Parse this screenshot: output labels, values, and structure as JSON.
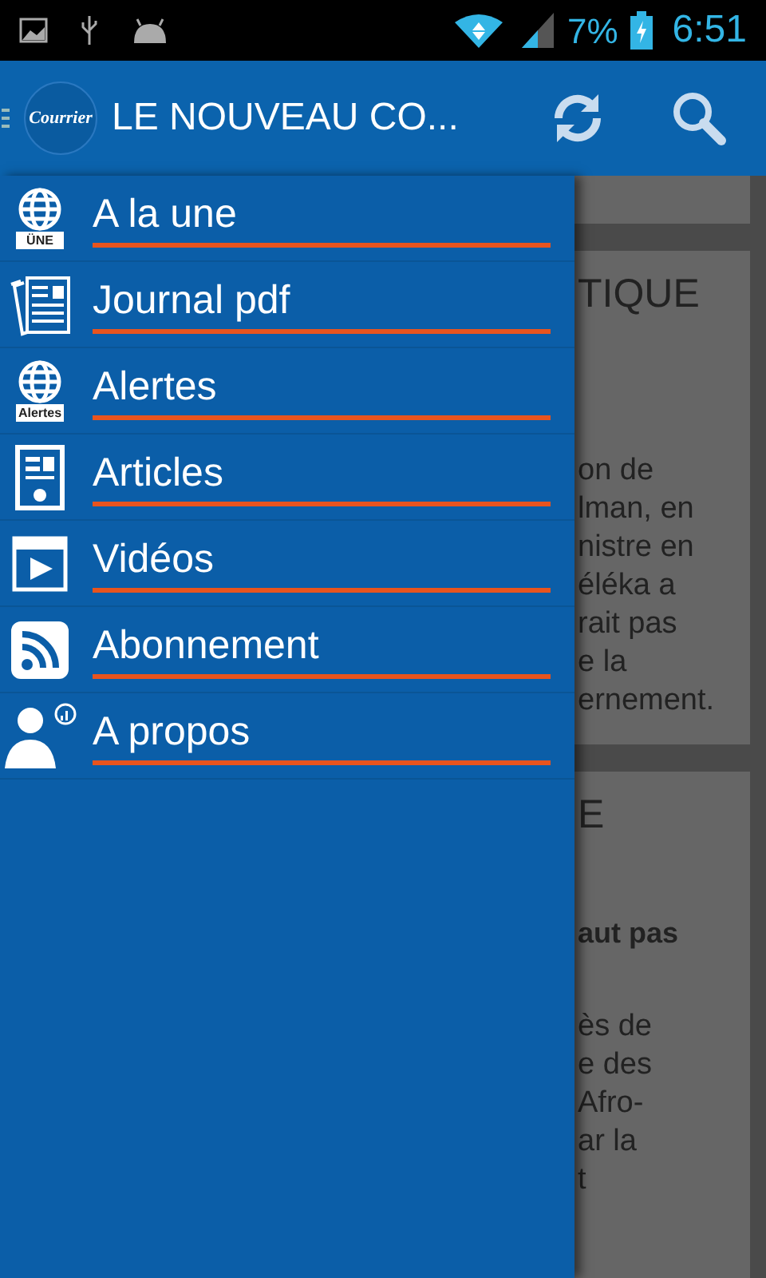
{
  "status_bar": {
    "battery": "7%",
    "time": "6:51"
  },
  "app_bar": {
    "logo_text": "Courrier",
    "title": "LE NOUVEAU CO..."
  },
  "drawer": {
    "items": [
      {
        "label": "A la une",
        "icon_text": "ÜNE"
      },
      {
        "label": "Journal pdf"
      },
      {
        "label": "Alertes",
        "icon_text": "Alertes"
      },
      {
        "label": "Articles"
      },
      {
        "label": "Vidéos"
      },
      {
        "label": "Abonnement"
      },
      {
        "label": "A propos"
      }
    ]
  },
  "background_cards": [
    {
      "title": "TIQUE",
      "lines": [
        "on de",
        "lman, en",
        "nistre en",
        "éléka a",
        "rait pas",
        "e la",
        "ernement."
      ]
    },
    {
      "title": "E",
      "subtitle": "aut pas",
      "lines": [
        "ès de",
        "e des",
        "Afro-",
        "ar la",
        "t"
      ]
    }
  ]
}
